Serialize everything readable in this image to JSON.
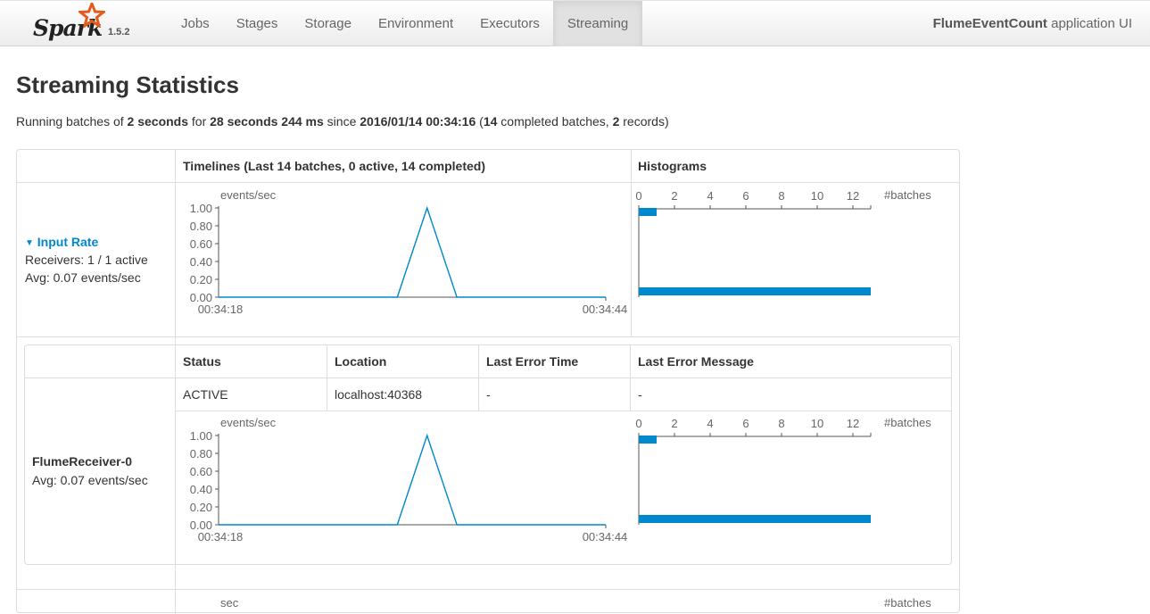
{
  "brand": {
    "name": "Spark",
    "version": "1.5.2"
  },
  "nav": {
    "items": [
      "Jobs",
      "Stages",
      "Storage",
      "Environment",
      "Executors",
      "Streaming"
    ],
    "active": "Streaming"
  },
  "app": {
    "name": "FlumeEventCount",
    "suffix": " application UI"
  },
  "page": {
    "title": "Streaming Statistics"
  },
  "summary": {
    "t1": "Running batches of ",
    "interval": "2 seconds",
    "t2": " for ",
    "duration": "28 seconds 244 ms",
    "t3": " since ",
    "since": "2016/01/14 00:34:16",
    "t4": " (",
    "completed": "14",
    "t5": " completed batches, ",
    "records": "2",
    "t6": " records)"
  },
  "table": {
    "timelines_header": "Timelines (Last 14 batches, 0 active, 14 completed)",
    "histograms_header": "Histograms"
  },
  "input_rate": {
    "label": "Input Rate",
    "receivers": "Receivers: 1 / 1 active",
    "avg": "Avg: 0.07 events/sec"
  },
  "receivers_table": {
    "headers": [
      "Status",
      "Location",
      "Last Error Time",
      "Last Error Message"
    ],
    "rows": [
      {
        "name": "FlumeReceiver-0",
        "avg": "Avg: 0.07 events/sec",
        "status": "ACTIVE",
        "location": "localhost:40368",
        "last_error_time": "-",
        "last_error_message": "-"
      }
    ]
  },
  "partial_row": {
    "timeline_unit": "sec",
    "hist_unit": "#batches"
  },
  "chart_data": [
    {
      "type": "line",
      "ylabel": "events/sec",
      "x_tick_labels": [
        "00:34:18",
        "00:34:44"
      ],
      "y_ticks": [
        "0.00",
        "0.20",
        "0.40",
        "0.60",
        "0.80",
        "1.00"
      ],
      "ylim": [
        0,
        1
      ],
      "series": [
        {
          "values": [
            0,
            0,
            0,
            0,
            0,
            0,
            0,
            1,
            0,
            0,
            0,
            0,
            0,
            0
          ]
        }
      ],
      "color": "#0088cc"
    },
    {
      "type": "bar",
      "xlabel": "#batches",
      "x_ticks": [
        "0",
        "2",
        "4",
        "6",
        "8",
        "10",
        "12"
      ],
      "xlim": [
        0,
        13
      ],
      "bins": [
        {
          "range": "1.00",
          "count": 1
        },
        {
          "range": "0.00",
          "count": 13
        }
      ],
      "color": "#0088cc"
    },
    {
      "type": "line",
      "ylabel": "events/sec",
      "x_tick_labels": [
        "00:34:18",
        "00:34:44"
      ],
      "y_ticks": [
        "0.00",
        "0.20",
        "0.40",
        "0.60",
        "0.80",
        "1.00"
      ],
      "ylim": [
        0,
        1
      ],
      "series": [
        {
          "values": [
            0,
            0,
            0,
            0,
            0,
            0,
            0,
            1,
            0,
            0,
            0,
            0,
            0,
            0
          ]
        }
      ],
      "color": "#0088cc"
    },
    {
      "type": "bar",
      "xlabel": "#batches",
      "x_ticks": [
        "0",
        "2",
        "4",
        "6",
        "8",
        "10",
        "12"
      ],
      "xlim": [
        0,
        13
      ],
      "bins": [
        {
          "range": "1.00",
          "count": 1
        },
        {
          "range": "0.00",
          "count": 13
        }
      ],
      "color": "#0088cc"
    }
  ]
}
